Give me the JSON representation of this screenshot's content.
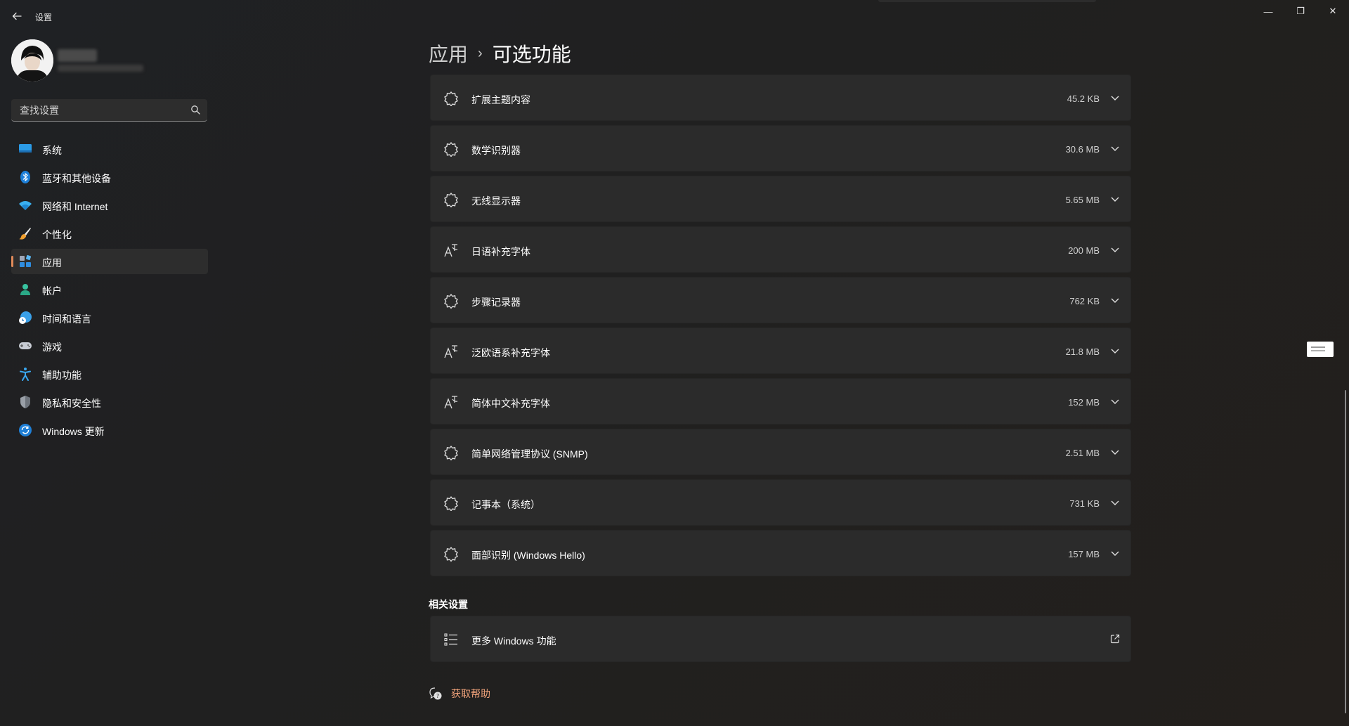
{
  "window": {
    "title": "设置",
    "controls": {
      "minimize": "—",
      "maximize": "❐",
      "close": "✕"
    }
  },
  "sidebar": {
    "search_placeholder": "查找设置",
    "items": [
      {
        "label": "系统",
        "icon": "system-icon",
        "active": false
      },
      {
        "label": "蓝牙和其他设备",
        "icon": "bluetooth-icon",
        "active": false
      },
      {
        "label": "网络和 Internet",
        "icon": "wifi-icon",
        "active": false
      },
      {
        "label": "个性化",
        "icon": "brush-icon",
        "active": false
      },
      {
        "label": "应用",
        "icon": "apps-icon",
        "active": true
      },
      {
        "label": "帐户",
        "icon": "account-icon",
        "active": false
      },
      {
        "label": "时间和语言",
        "icon": "globe-clock-icon",
        "active": false
      },
      {
        "label": "游戏",
        "icon": "gamepad-icon",
        "active": false
      },
      {
        "label": "辅助功能",
        "icon": "accessibility-icon",
        "active": false
      },
      {
        "label": "隐私和安全性",
        "icon": "shield-icon",
        "active": false
      },
      {
        "label": "Windows 更新",
        "icon": "update-icon",
        "active": false
      }
    ]
  },
  "breadcrumb": {
    "parent": "应用",
    "separator": "›",
    "current": "可选功能"
  },
  "features": [
    {
      "label": "扩展主题内容",
      "size": "45.2 KB",
      "icon": "puzzle-gear-icon"
    },
    {
      "label": "数学识别器",
      "size": "30.6 MB",
      "icon": "puzzle-gear-icon"
    },
    {
      "label": "无线显示器",
      "size": "5.65 MB",
      "icon": "puzzle-gear-icon"
    },
    {
      "label": "日语补充字体",
      "size": "200 MB",
      "icon": "font-icon"
    },
    {
      "label": "步骤记录器",
      "size": "762 KB",
      "icon": "puzzle-gear-icon"
    },
    {
      "label": "泛欧语系补充字体",
      "size": "21.8 MB",
      "icon": "font-icon"
    },
    {
      "label": "简体中文补充字体",
      "size": "152 MB",
      "icon": "font-icon"
    },
    {
      "label": "简单网络管理协议 (SNMP)",
      "size": "2.51 MB",
      "icon": "puzzle-gear-icon"
    },
    {
      "label": "记事本（系统）",
      "size": "731 KB",
      "icon": "puzzle-gear-icon"
    },
    {
      "label": "面部识别 (Windows Hello)",
      "size": "157 MB",
      "icon": "puzzle-gear-icon"
    }
  ],
  "related": {
    "title": "相关设置",
    "items": [
      {
        "label": "更多 Windows 功能",
        "icon": "list-icon"
      }
    ]
  },
  "help": {
    "label": "获取帮助"
  },
  "colors": {
    "accent": "#e08a5a",
    "link": "#f0a27a",
    "card": "#2b2b2b",
    "background": "#202020"
  }
}
